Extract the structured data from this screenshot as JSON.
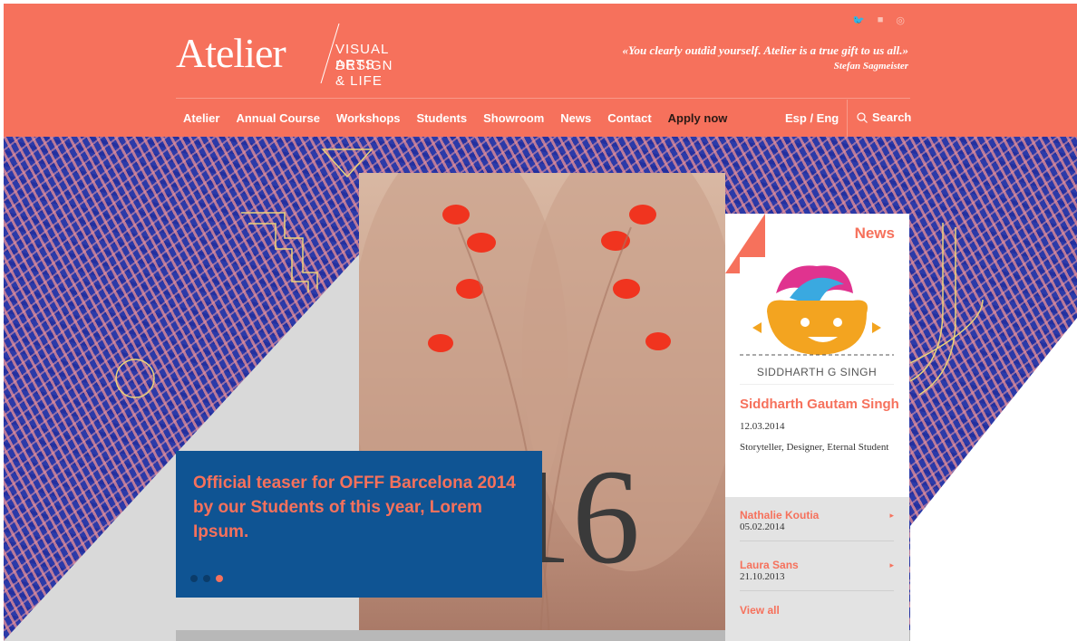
{
  "header": {
    "logo_word": "Atelier",
    "logo_tag_line1": "VISUAL ARTS",
    "logo_tag_line2": "DESIGN & LIFE",
    "quote_text": "«You clearly outdid yourself. Atelier is a true gift to us all.»",
    "quote_author": "Stefan Sagmeister",
    "social_icons": [
      "twitter-icon",
      "facebook-icon",
      "pinterest-icon"
    ]
  },
  "nav": {
    "items": [
      "Atelier",
      "Annual Course",
      "Workshops",
      "Students",
      "Showroom",
      "News",
      "Contact"
    ],
    "apply": "Apply now",
    "lang": "Esp / Eng",
    "search": "Search"
  },
  "hero": {
    "caption": "Official teaser for OFFF Barcelona 2014 by our Students of this year, Lorem Ipsum.",
    "slide_count": 3,
    "active_slide": 3,
    "photo_number": "16"
  },
  "news": {
    "title": "News",
    "image_caption": "SIDDHARTH G SINGH",
    "featured_name": "Siddharth Gautam Singh",
    "featured_date": "12.03.2014",
    "featured_desc": "Storyteller, Designer, Eternal Student",
    "items": [
      {
        "name": "Nathalie Koutia",
        "date": "05.02.2014"
      },
      {
        "name": "Laura Sans",
        "date": "21.10.2013"
      }
    ],
    "view_all": "View all"
  },
  "colors": {
    "accent": "#f6715c",
    "caption_bg": "#0f5493",
    "hero_blue": "#2c3aa8",
    "hero_pink": "#e88f96"
  }
}
